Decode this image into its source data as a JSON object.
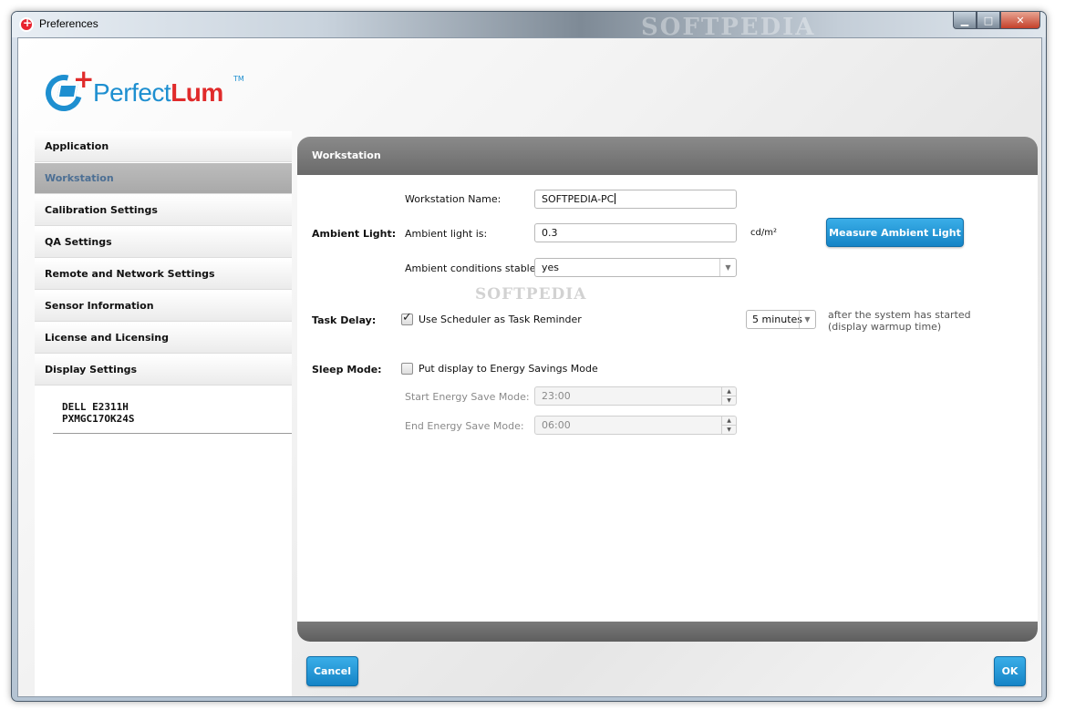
{
  "window": {
    "title": "Preferences",
    "watermark": "SOFTPEDIA",
    "min_glyph": "▁",
    "max_glyph": "□",
    "close_glyph": "✕"
  },
  "logo": {
    "text_a": "Perfect",
    "text_b": "Lum",
    "tm": "TM",
    "plus": "+"
  },
  "sidebar": {
    "items": [
      {
        "label": "Application"
      },
      {
        "label": "Workstation"
      },
      {
        "label": "Calibration Settings"
      },
      {
        "label": "QA Settings"
      },
      {
        "label": "Remote and Network Settings"
      },
      {
        "label": "Sensor Information"
      },
      {
        "label": "License and Licensing"
      },
      {
        "label": "Display Settings"
      }
    ],
    "active_index": 1,
    "display": {
      "line1": "DELL E2311H",
      "line2": "PXMGC17OK24S"
    }
  },
  "panel": {
    "title": "Workstation",
    "workstation_name_label": "Workstation Name:",
    "workstation_name_value": "SOFTPEDIA-PC",
    "ambient_section": "Ambient Light:",
    "ambient_label": "Ambient light is:",
    "ambient_value": "0.3",
    "ambient_unit": "cd/m²",
    "measure_button": "Measure Ambient Light",
    "stable_label": "Ambient conditions stable:",
    "stable_value": "yes",
    "watermark": "SOFTPEDIA",
    "task_section": "Task Delay:",
    "scheduler_label": "Use Scheduler as Task Reminder",
    "scheduler_checked": true,
    "delay_value": "5 minutes",
    "delay_note": "after the system has started (display warmup time)",
    "sleep_section": "Sleep Mode:",
    "energy_label": "Put display to Energy Savings Mode",
    "energy_checked": false,
    "start_label": "Start Energy Save Mode:",
    "start_value": "23:00",
    "end_label": "End Energy Save Mode:",
    "end_value": "06:00"
  },
  "footer": {
    "cancel": "Cancel",
    "ok": "OK"
  },
  "colors": {
    "accent": "#1e8fd0",
    "brand_red": "#e02b2b",
    "active_sidebar_text": "#4c6f94"
  }
}
